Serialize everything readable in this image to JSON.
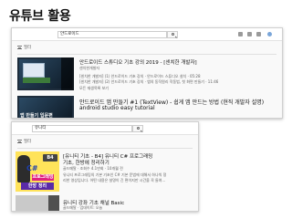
{
  "slide_title": "유튜브 활용",
  "screenshot1": {
    "search_value": "안드로이드",
    "filter_label": "필터",
    "results": [
      {
        "title": "안드로이드 스튜디오 기초 강의 2019 - [센치한 개발자]",
        "channel": "센치한개발자",
        "desc": "[센치한 개발자] (1) 안드로이드 기초 강의 · 안드로이드 스튜디오 설치 · 05:28",
        "desc2": "[센치한 개발자] (2) 안드로이드 기초 강의 · 앱의 동작원리 작동법, 첫 화면 만들기 · 11:46",
        "link": "모든 재생목록 보기"
      },
      {
        "title": "안드로이드 앱 만들기 #1 (TextView) - 쉽게 앱 만드는 방법 (현직 개발자 설명)",
        "title2": "android studio easy tutorial",
        "thumb_caption": "앱 만들기 입문편"
      }
    ]
  },
  "screenshot2": {
    "search_value": "유니티",
    "filter_label": "필터",
    "results": [
      {
        "title": "[유니티 기초 - B4] 유니티 C# 프로그래밍",
        "title2": "기초, 한방에 정리하기",
        "channel": "골드메탈 · 조회수 4.1만회 · 10개월 전",
        "desc": "유니티 프로그래밍의 기본 기초인 C# 기본 문법에 대해서 하나씩 정",
        "desc2": "리한 영상입니다. 어떤 내용은 설명이 긴 편이지만 시간을 꼭 들여...",
        "thumb_ep": "B4",
        "thumb_c": "C#",
        "thumb_pink": "프로그래밍",
        "thumb_bottom": "한방 정리"
      },
      {
        "title": "유니티 강좌 기초 채널 Basic",
        "channel": "골드메탈 · 업데이트: 오늘"
      }
    ]
  }
}
